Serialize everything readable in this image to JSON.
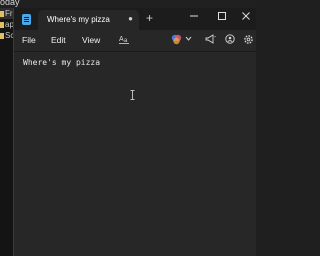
{
  "background_app": {
    "top_label": "oday",
    "sidebar_items": [
      {
        "label": "Fr",
        "selected": true
      },
      {
        "label": "ap",
        "selected": false
      },
      {
        "label": "Sc",
        "selected": false
      }
    ]
  },
  "window": {
    "tab": {
      "title": "Where's my pizza",
      "close_glyph": "●",
      "app_icon": "notepad-icon"
    },
    "new_tab_glyph": "+",
    "controls": {
      "minimize": "—",
      "maximize": "☐",
      "close": "✕"
    },
    "menu": {
      "file": "File",
      "edit": "Edit",
      "view": "View",
      "format_icon_glyph": "A͟a"
    },
    "toolbar_icons": [
      "copilot-icon",
      "chevron-down-icon",
      "megaphone-icon",
      "account-icon",
      "settings-icon"
    ]
  },
  "editor": {
    "content": "Where's my pizza"
  },
  "colors": {
    "titlebar": "#1c1c1c",
    "editor_bg": "#272727",
    "accent": "#4aa8e8"
  }
}
